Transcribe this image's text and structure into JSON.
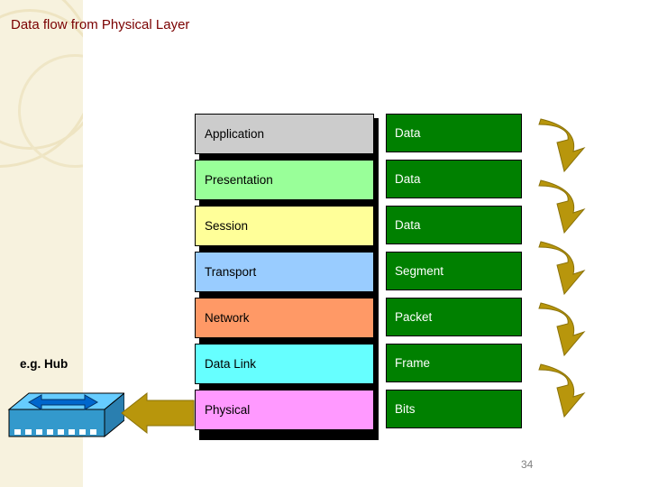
{
  "title": "Data flow from Physical Layer",
  "page_number": "34",
  "hub": {
    "label": "e.g. Hub"
  },
  "osi": {
    "layers": [
      {
        "name": "Application",
        "color": "#cccccc",
        "pdu": "Data"
      },
      {
        "name": "Presentation",
        "color": "#99ff99",
        "pdu": "Data"
      },
      {
        "name": "Session",
        "color": "#ffff99",
        "pdu": "Data"
      },
      {
        "name": "Transport",
        "color": "#99ccff",
        "pdu": "Segment"
      },
      {
        "name": "Network",
        "color": "#ff9966",
        "pdu": "Packet"
      },
      {
        "name": "Data Link",
        "color": "#66ffff",
        "pdu": "Frame"
      },
      {
        "name": "Physical",
        "color": "#ff99ff",
        "pdu": "Bits"
      }
    ],
    "pdu_background": "#008000",
    "pdu_text_color": "#ffffff"
  },
  "colors": {
    "title": "#7a0000",
    "band": "#f7f2de",
    "ribbon": "#b8960c",
    "hub_body": "#3399cc",
    "hub_top": "#66ccff",
    "arrow_fill": "#b8960c",
    "hub_arrow": "#0066cc"
  }
}
